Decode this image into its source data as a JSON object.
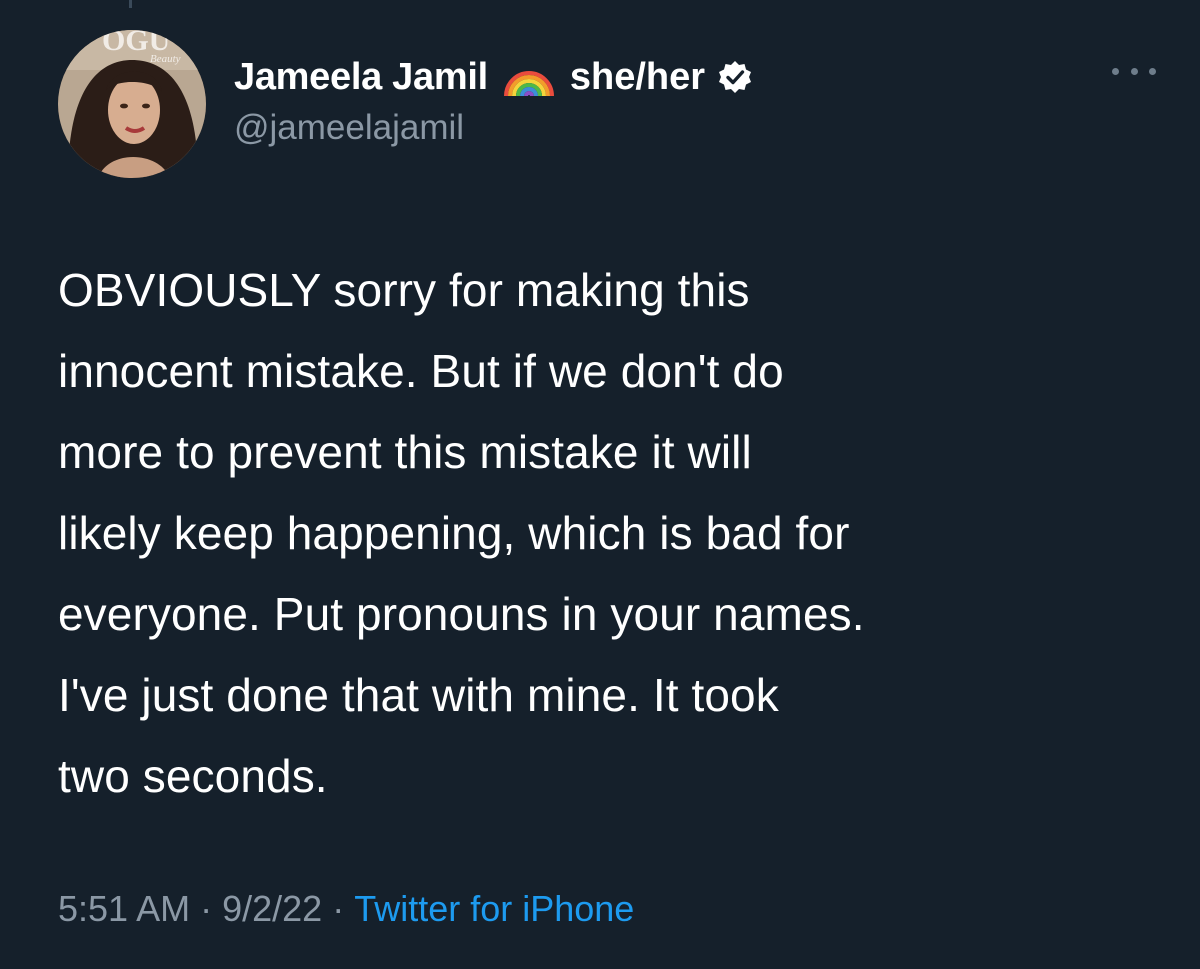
{
  "tweet": {
    "author": {
      "display_name": "Jameela Jamil",
      "pronouns": "she/her",
      "handle": "@jameelajamil",
      "verified": true,
      "avatar_text": "VOGUE Beauty"
    },
    "text_lines": [
      "OBVIOUSLY sorry for making this",
      "innocent mistake. But if we don't do",
      "more to prevent this mistake it will",
      "likely keep happening, which is bad for",
      "everyone. Put pronouns in your names.",
      "I've just done that with mine. It took",
      "two seconds."
    ],
    "time": "5:51 AM",
    "date": "9/2/22",
    "separator": "·",
    "source": "Twitter for iPhone"
  },
  "icons": {
    "rainbow": "rainbow-emoji-icon",
    "verified": "verified-badge-icon",
    "more": "more-options-icon"
  },
  "colors": {
    "background": "#15202b",
    "text_primary": "#ffffff",
    "text_secondary": "#8b98a5",
    "link": "#1d9bf0"
  }
}
